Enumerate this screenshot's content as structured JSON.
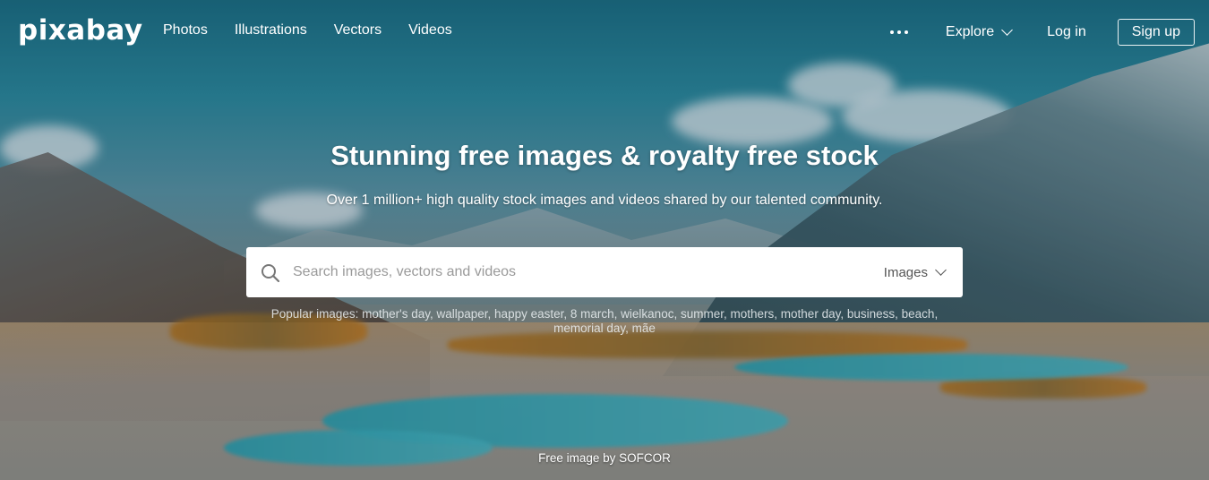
{
  "brand": {
    "logo_text": "pixabay"
  },
  "nav": {
    "links": [
      "Photos",
      "Illustrations",
      "Vectors",
      "Videos"
    ],
    "explore_label": "Explore",
    "login_label": "Log in",
    "signup_label": "Sign up"
  },
  "hero": {
    "headline": "Stunning free images & royalty free stock",
    "subline": "Over 1 million+ high quality stock images and videos shared by our talented community."
  },
  "search": {
    "placeholder": "Search images, vectors and videos",
    "type_selected": "Images",
    "icon": "search-icon"
  },
  "popular": {
    "prefix": "Popular images:",
    "tags": [
      "mother's day",
      "wallpaper",
      "happy easter",
      "8 march",
      "wielkanoc",
      "summer",
      "mothers",
      "mother day",
      "business",
      "beach",
      "memorial day",
      "mãe"
    ]
  },
  "credit": {
    "text": "Free image by SOFCOR"
  },
  "colors": {
    "text_on_image": "#ffffff",
    "search_bg": "#ffffff"
  }
}
